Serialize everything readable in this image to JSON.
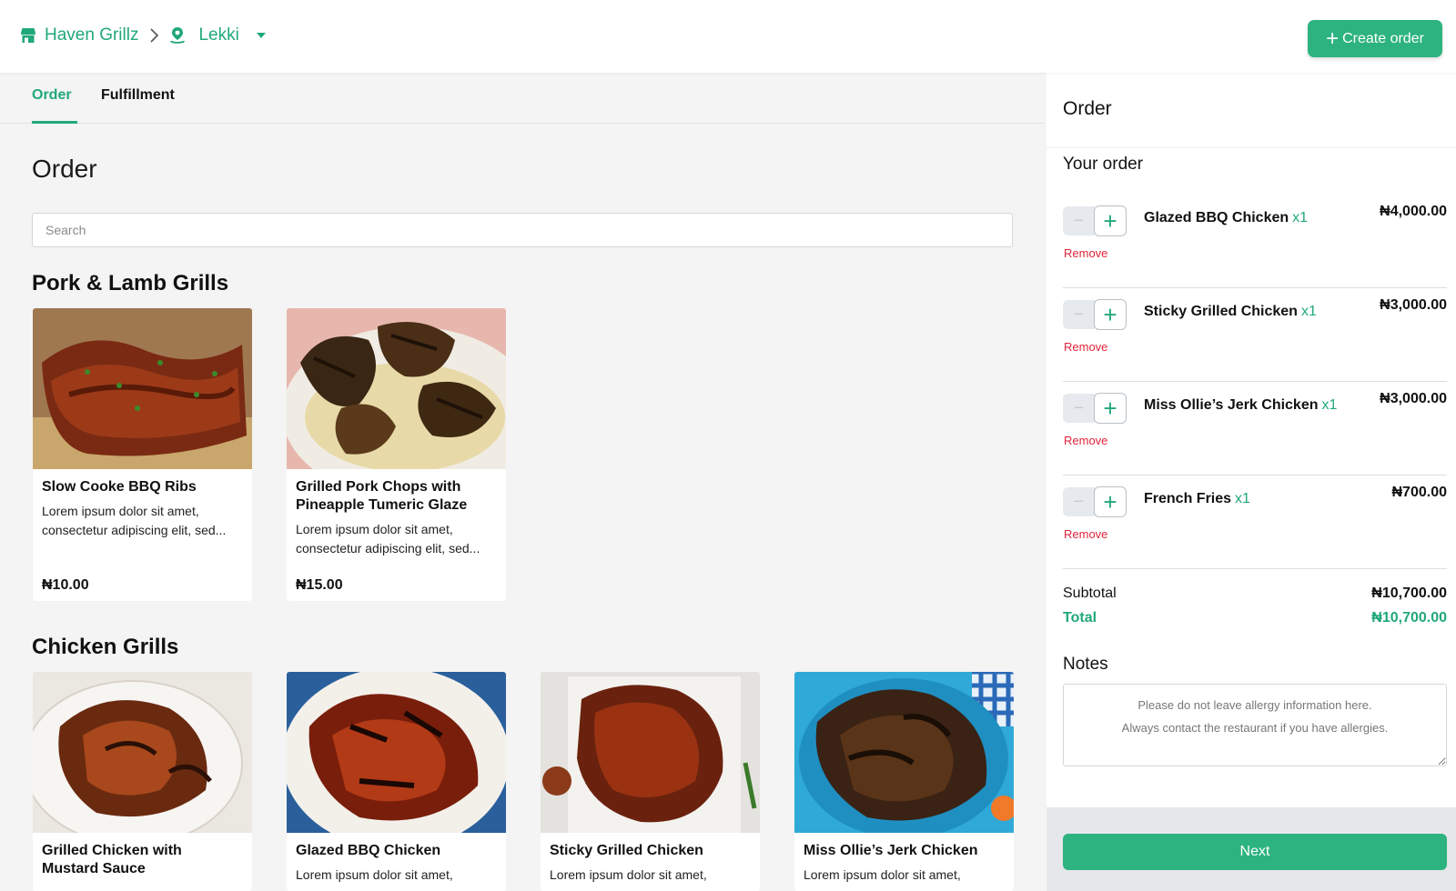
{
  "header": {
    "store_name": "Haven Grillz",
    "location": "Lekki",
    "create_order_label": "Create order",
    "colors": {
      "accent": "#2db37f",
      "accent_text": "#21a87a",
      "danger": "#e0243a"
    }
  },
  "tabs": [
    {
      "label": "Order",
      "active": true
    },
    {
      "label": "Fulfillment",
      "active": false
    }
  ],
  "main": {
    "title": "Order",
    "search_placeholder": "Search",
    "sections": [
      {
        "title": "Pork & Lamb Grills",
        "items": [
          {
            "name": "Slow Cooke BBQ Ribs",
            "desc_line1": "Lorem ipsum dolor sit amet,",
            "desc_line2": "consectetur adipiscing elit, sed...",
            "price": "₦10.00",
            "image": "bbq-ribs-photo"
          },
          {
            "name": "Grilled Pork Chops with Pineapple Tumeric Glaze",
            "desc_line1": "Lorem ipsum dolor sit amet,",
            "desc_line2": "consectetur adipiscing elit, sed...",
            "price": "₦15.00",
            "image": "pork-chops-photo"
          }
        ]
      },
      {
        "title": "Chicken Grills",
        "items": [
          {
            "name": "Grilled Chicken with Mustard Sauce",
            "desc_line1": "",
            "image": "mustard-chicken-photo"
          },
          {
            "name": "Glazed BBQ Chicken",
            "desc_line1": "Lorem ipsum dolor sit amet,",
            "image": "glazed-bbq-chicken-photo"
          },
          {
            "name": "Sticky Grilled Chicken",
            "desc_line1": "Lorem ipsum dolor sit amet,",
            "image": "sticky-chicken-photo"
          },
          {
            "name": "Miss Ollie’s Jerk Chicken",
            "desc_line1": "Lorem ipsum dolor sit amet,",
            "image": "jerk-chicken-photo"
          }
        ]
      }
    ]
  },
  "panel": {
    "title": "Order",
    "your_order_label": "Your order",
    "remove_label": "Remove",
    "minus_icon": "minus-icon",
    "plus_icon": "plus-icon",
    "items": [
      {
        "name": "Glazed BBQ Chicken",
        "qty": "x1",
        "price": "₦4,000.00"
      },
      {
        "name": "Sticky Grilled Chicken",
        "qty": "x1",
        "price": "₦3,000.00"
      },
      {
        "name": "Miss Ollie’s Jerk Chicken",
        "qty": "x1",
        "price": "₦3,000.00"
      },
      {
        "name": "French Fries",
        "qty": "x1",
        "price": "₦700.00"
      }
    ],
    "subtotal_label": "Subtotal",
    "subtotal_value": "₦10,700.00",
    "total_label": "Total",
    "total_value": "₦10,700.00",
    "notes_label": "Notes",
    "notes_placeholder": "Please do not leave allergy information here.\nAlways contact the restaurant if you have allergies.",
    "next_label": "Next"
  }
}
